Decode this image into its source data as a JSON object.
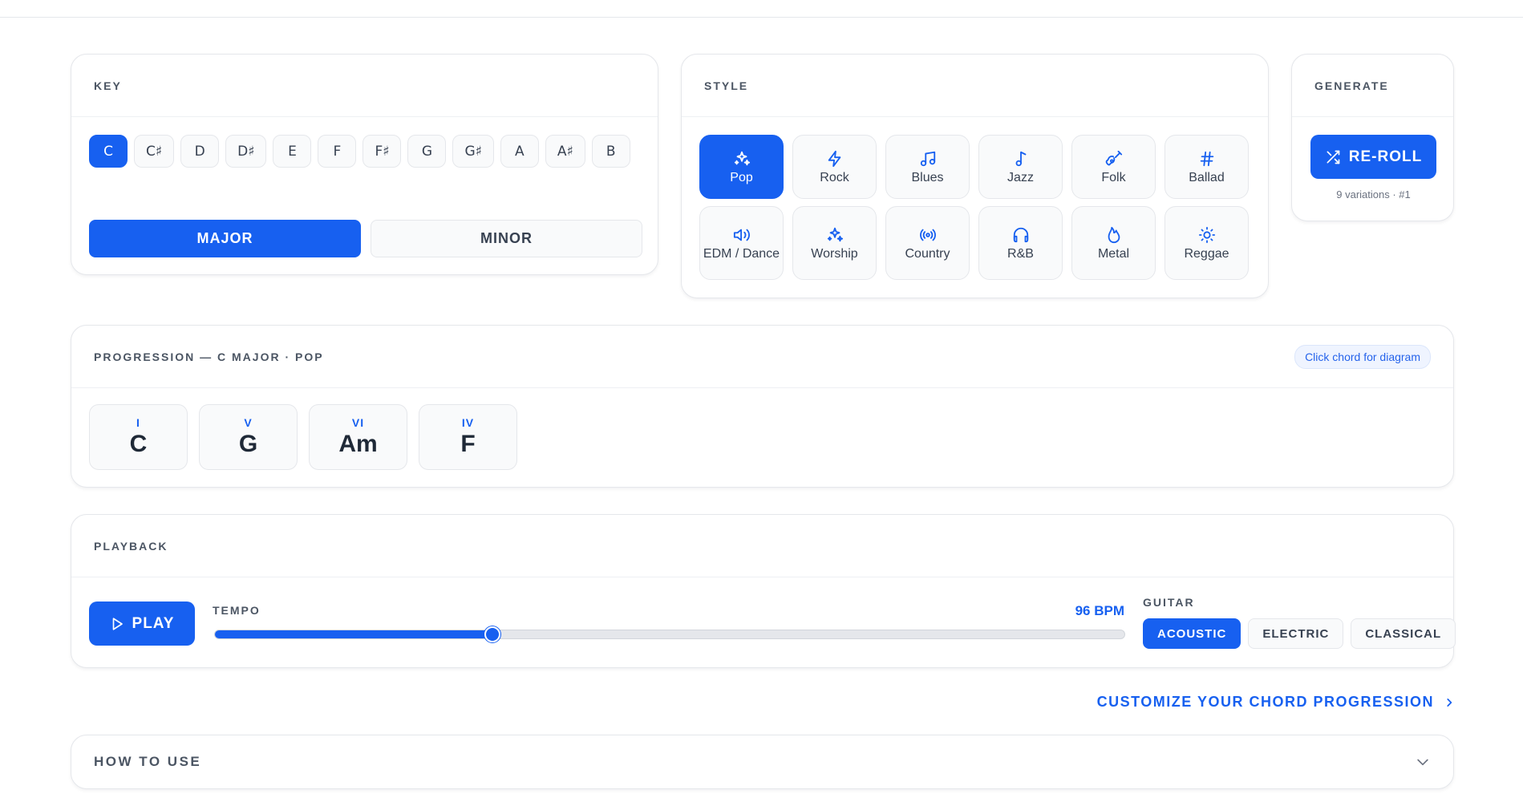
{
  "key": {
    "title": "KEY",
    "notes": [
      "C",
      "C♯",
      "D",
      "D♯",
      "E",
      "F",
      "F♯",
      "G",
      "G♯",
      "A",
      "A♯",
      "B"
    ],
    "selected_note": "C",
    "modes": [
      "MAJOR",
      "MINOR"
    ],
    "selected_mode": "MAJOR"
  },
  "style": {
    "title": "STYLE",
    "items": [
      {
        "label": "Pop",
        "icon": "sparkles-icon"
      },
      {
        "label": "Rock",
        "icon": "lightning-icon"
      },
      {
        "label": "Blues",
        "icon": "music-notes-icon"
      },
      {
        "label": "Jazz",
        "icon": "music-note-icon"
      },
      {
        "label": "Folk",
        "icon": "guitar-icon"
      },
      {
        "label": "Ballad",
        "icon": "hash-icon"
      },
      {
        "label": "EDM / Dance",
        "icon": "speaker-icon"
      },
      {
        "label": "Worship",
        "icon": "sparkles-icon"
      },
      {
        "label": "Country",
        "icon": "radio-icon"
      },
      {
        "label": "R&B",
        "icon": "headphones-icon"
      },
      {
        "label": "Metal",
        "icon": "flame-icon"
      },
      {
        "label": "Reggae",
        "icon": "sun-icon"
      }
    ],
    "selected": "Pop"
  },
  "generate": {
    "title": "GENERATE",
    "button_label": "RE-ROLL",
    "variations_text": "9 variations · #1"
  },
  "progression": {
    "title": "PROGRESSION — C MAJOR · POP",
    "hint": "Click chord for diagram",
    "chords": [
      {
        "numeral": "I",
        "name": "C"
      },
      {
        "numeral": "V",
        "name": "G"
      },
      {
        "numeral": "VI",
        "name": "Am"
      },
      {
        "numeral": "IV",
        "name": "F"
      }
    ]
  },
  "playback": {
    "title": "PLAYBACK",
    "play_label": "PLAY",
    "tempo_label": "TEMPO",
    "tempo_value": "96 BPM",
    "tempo_fraction": 0.305,
    "guitar_label": "GUITAR",
    "guitar_options": [
      "ACOUSTIC",
      "ELECTRIC",
      "CLASSICAL"
    ],
    "guitar_selected": "ACOUSTIC"
  },
  "customize_link": "CUSTOMIZE YOUR CHORD PROGRESSION",
  "how_to_use": "HOW TO USE",
  "colors": {
    "accent": "#1760f0",
    "border": "#e5e7eb",
    "muted": "#4b5563"
  }
}
